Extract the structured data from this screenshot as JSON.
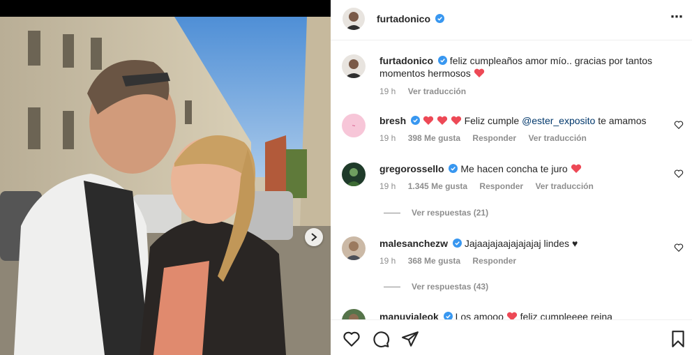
{
  "post": {
    "author": "furtadonico",
    "more_icon": "⋯"
  },
  "caption": {
    "username": "furtadonico",
    "text": "feliz cumpleaños amor mío.. gracias por tantos momentos hermosos",
    "time": "19 h",
    "translate": "Ver traducción"
  },
  "comments": [
    {
      "username": "bresh",
      "text_pre": "Feliz cumple",
      "mention": "@ester_exposito",
      "text_post": "te amamos",
      "time": "19 h",
      "likes": "398 Me gusta",
      "reply": "Responder",
      "translate": "Ver traducción"
    },
    {
      "username": "gregorossello",
      "text": "Me hacen concha te juro",
      "time": "19 h",
      "likes": "1.345 Me gusta",
      "reply": "Responder",
      "translate": "Ver traducción",
      "view_replies": "Ver respuestas (21)"
    },
    {
      "username": "malesanchezw",
      "text": "Jajaajajaajajajajaj lindes ♥",
      "time": "19 h",
      "likes": "368 Me gusta",
      "reply": "Responder",
      "view_replies": "Ver respuestas (43)"
    },
    {
      "username": "manuvialeok",
      "text_pre": "Los amooo",
      "text_post": "feliz cumpleeee reina"
    }
  ],
  "colors": {
    "verified": "#3897f0",
    "heart_red": "#ed4956",
    "mention": "#00376b",
    "muted": "#8e8e8e"
  }
}
